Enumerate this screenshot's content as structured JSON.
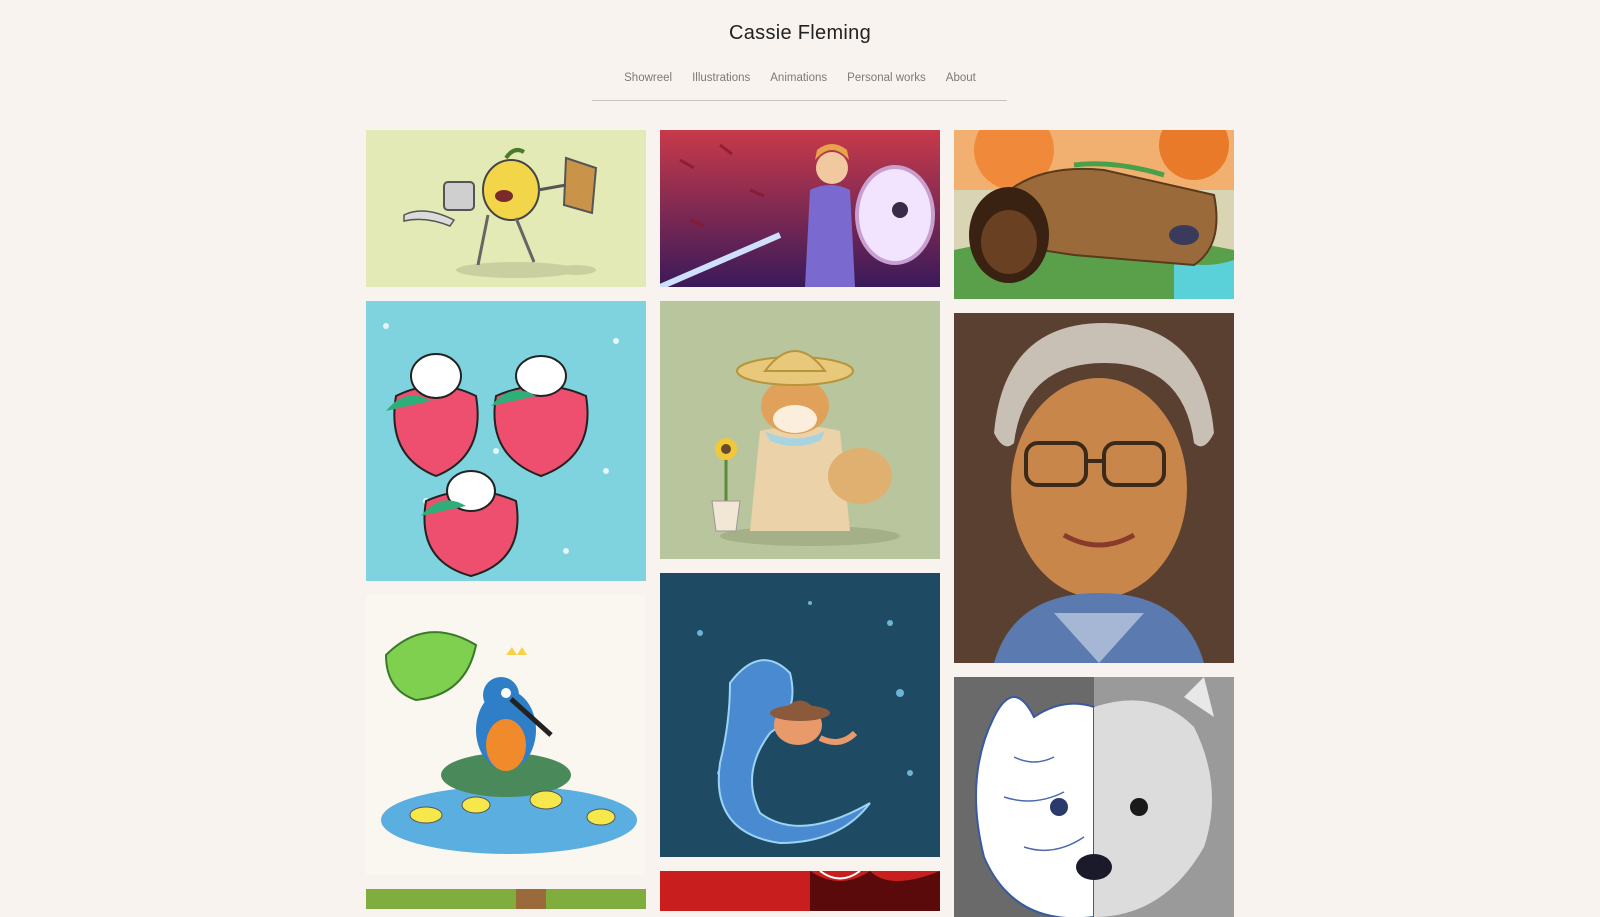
{
  "site": {
    "title": "Cassie Fleming"
  },
  "nav": {
    "items": [
      {
        "label": "Showreel"
      },
      {
        "label": "Illustrations"
      },
      {
        "label": "Animations"
      },
      {
        "label": "Personal works"
      },
      {
        "label": "About"
      }
    ]
  },
  "gallery": {
    "tiles": [
      {
        "icon": "lemon-robot-knight-artwork",
        "bg": "#e3eab5"
      },
      {
        "icon": "elf-warrior-shield-artwork",
        "bg": "#6b2442"
      },
      {
        "icon": "fallen-log-forest-artwork",
        "bg": "#e89a4e"
      },
      {
        "icon": "strawberry-bunnies-artwork",
        "bg": "#7fd3df"
      },
      {
        "icon": "shiba-sunflower-artwork",
        "bg": "#b9c59c"
      },
      {
        "icon": "elderly-woman-portrait-artwork",
        "bg": "#6b5040"
      },
      {
        "icon": "kingfisher-pond-artwork",
        "bg": "#faf6f0"
      },
      {
        "icon": "seahorse-crab-rider-artwork",
        "bg": "#1f4a63"
      },
      {
        "icon": "westie-dog-sketch-artwork",
        "bg": "#8a8a8a"
      },
      {
        "icon": "green-artwork-partial",
        "bg": "#7fae3f"
      },
      {
        "icon": "red-artwork-partial",
        "bg": "#c91e1e"
      }
    ]
  }
}
